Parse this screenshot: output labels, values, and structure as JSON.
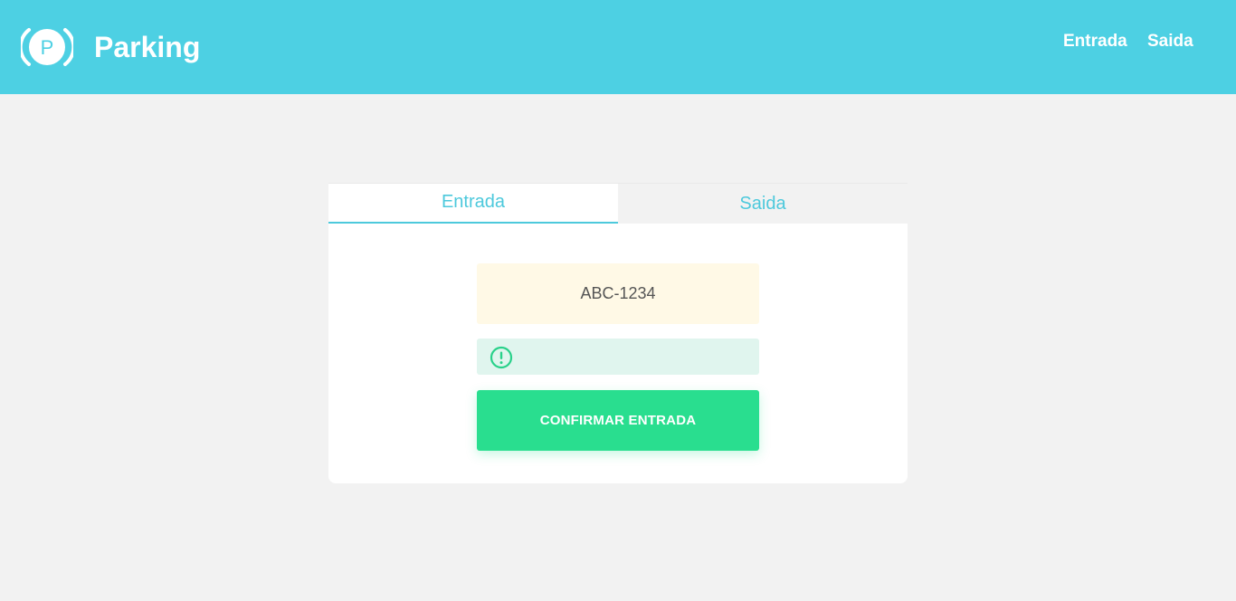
{
  "header": {
    "brand": "Parking",
    "logo_letter": "P",
    "nav": [
      {
        "label": "Entrada"
      },
      {
        "label": "Saida"
      }
    ]
  },
  "tabs": [
    {
      "label": "Entrada",
      "active": true
    },
    {
      "label": "Saida",
      "active": false
    }
  ],
  "form": {
    "plate_value": "ABC-1234",
    "confirm_label": "CONFIRMAR ENTRADA",
    "alert_icon": "exclamation-circle-icon"
  },
  "colors": {
    "header_bg": "#4dd0e3",
    "accent": "#4dc9dc",
    "confirm": "#29de8f",
    "plate_bg": "#fff9e6",
    "alert_bg": "#e0f5ee"
  }
}
